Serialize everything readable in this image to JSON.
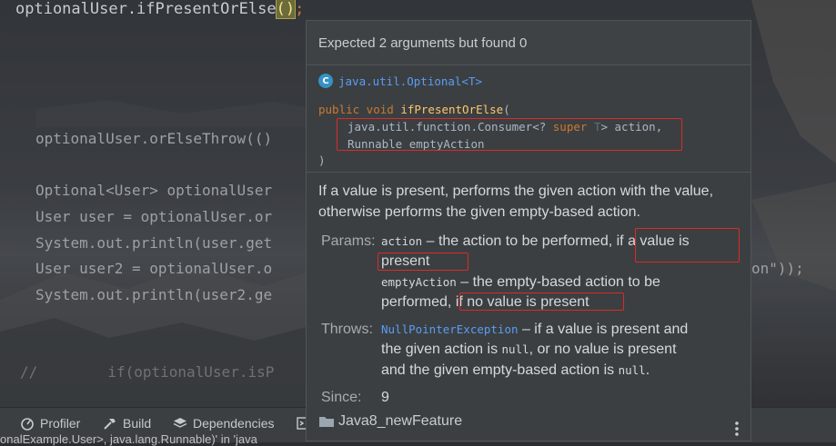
{
  "editor": {
    "line_top_code": "optionalUser.ifPresentOrElse",
    "line_top_paren": "()",
    "line_top_semi": ";",
    "lines": [
      "optionalUser.orElseThrow(()",
      "Optional<User> optionalUser",
      "User user = optionalUser.or",
      "System.out.println(user.get",
      "User user2 = optionalUser.o",
      "System.out.println(user2.ge",
      "//        if(optionalUser.isP"
    ],
    "right_fragment": "on\"));"
  },
  "popup": {
    "error": "Expected 2 arguments but found 0",
    "class_icon": "C",
    "class_name": "java.util.Optional<T>",
    "sig": {
      "line1_mod": "public void ",
      "line1_fn": "ifPresentOrElse",
      "line1_paren": "(",
      "line2_a": "java.util.function.Consumer<? ",
      "line2_super": "super",
      "line2_t": " T",
      "line2_b": "> action,",
      "line3": "Runnable emptyAction",
      "line4": ")"
    },
    "description": "If a value is present, performs the given action with the value, otherwise performs the given empty-based action.",
    "params_label": "Params:",
    "param1_name": "action",
    "param1_text": " – the action to be performed, ",
    "param1_hl": "if a value is",
    "param1_cont": "present",
    "param2_name": "emptyAction",
    "param2_text": " – the empty-based action to be",
    "param2_cont": "performed, ",
    "param2_hl": "if no value is present",
    "throws_label": "Throws:",
    "throws_exc": "NullPointerException",
    "throws_t1": " – if a value is present and",
    "throws_t2a": "the given action is ",
    "throws_null1": "null",
    "throws_t2b": ", or no value is present",
    "throws_t3a": "and the given empty-based action is ",
    "throws_null2": "null",
    "throws_t3b": ".",
    "since_label": "Since:",
    "since_value": "9",
    "module": "Java8_newFeature"
  },
  "toolbar": {
    "profiler": "Profiler",
    "build": "Build",
    "dependencies": "Dependencies"
  },
  "status_message": "onalExample.User>, java.lang.Runnable)' in 'java"
}
